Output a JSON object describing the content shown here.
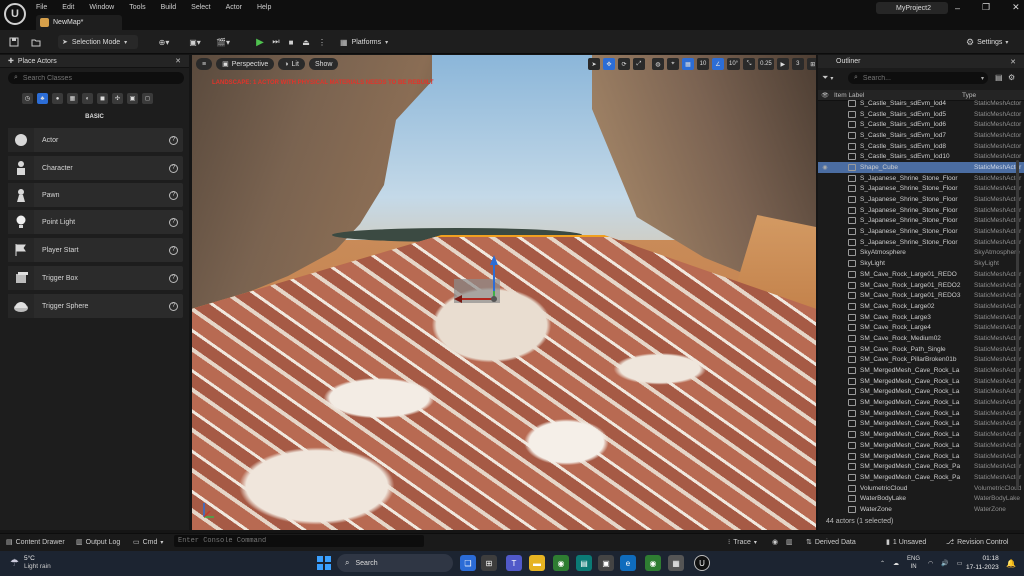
{
  "menu": [
    "File",
    "Edit",
    "Window",
    "Tools",
    "Build",
    "Select",
    "Actor",
    "Help"
  ],
  "map_tab": "NewMap*",
  "project_name": "MyProject2",
  "toolbar": {
    "selection_mode": "Selection Mode",
    "platforms": "Platforms",
    "settings": "Settings"
  },
  "place_actors": {
    "title": "Place Actors",
    "search_placeholder": "Search Classes",
    "section": "BASIC",
    "items": [
      "Actor",
      "Character",
      "Pawn",
      "Point Light",
      "Player Start",
      "Trigger Box",
      "Trigger Sphere"
    ]
  },
  "viewport": {
    "perspective": "Perspective",
    "lit": "Lit",
    "show": "Show",
    "warning": "LANDSCAPE: 1 ACTOR WITH PHYSICAL MATERIALS NEEDS TO BE REBUILT",
    "grid": "10",
    "angle": "10°",
    "scale": "0.25",
    "camera_speed": "3"
  },
  "outliner": {
    "title": "Outliner",
    "search_placeholder": "Search...",
    "col_label": "Item Label",
    "col_type": "Type",
    "rows": [
      {
        "name": "S_Castle_Stairs_sdEvm_lod4",
        "type": "StaticMeshActor"
      },
      {
        "name": "S_Castle_Stairs_sdEvm_lod5",
        "type": "StaticMeshActor"
      },
      {
        "name": "S_Castle_Stairs_sdEvm_lod6",
        "type": "StaticMeshActor"
      },
      {
        "name": "S_Castle_Stairs_sdEvm_lod7",
        "type": "StaticMeshActor"
      },
      {
        "name": "S_Castle_Stairs_sdEvm_lod8",
        "type": "StaticMeshActor"
      },
      {
        "name": "S_Castle_Stairs_sdEvm_lod10",
        "type": "StaticMeshActor"
      },
      {
        "name": "Shape_Cube",
        "type": "StaticMeshActor"
      },
      {
        "name": "S_Japanese_Shrine_Stone_Floor",
        "type": "StaticMeshActor"
      },
      {
        "name": "S_Japanese_Shrine_Stone_Floor",
        "type": "StaticMeshActor"
      },
      {
        "name": "S_Japanese_Shrine_Stone_Floor",
        "type": "StaticMeshActor"
      },
      {
        "name": "S_Japanese_Shrine_Stone_Floor",
        "type": "StaticMeshActor"
      },
      {
        "name": "S_Japanese_Shrine_Stone_Floor",
        "type": "StaticMeshActor"
      },
      {
        "name": "S_Japanese_Shrine_Stone_Floor",
        "type": "StaticMeshActor"
      },
      {
        "name": "S_Japanese_Shrine_Stone_Floor",
        "type": "StaticMeshActor"
      },
      {
        "name": "SkyAtmosphere",
        "type": "SkyAtmosphere"
      },
      {
        "name": "SkyLight",
        "type": "SkyLight"
      },
      {
        "name": "SM_Cave_Rock_Large01_REDO",
        "type": "StaticMeshActor"
      },
      {
        "name": "SM_Cave_Rock_Large01_REDO2",
        "type": "StaticMeshActor"
      },
      {
        "name": "SM_Cave_Rock_Large01_REDO3",
        "type": "StaticMeshActor"
      },
      {
        "name": "SM_Cave_Rock_Large02",
        "type": "StaticMeshActor"
      },
      {
        "name": "SM_Cave_Rock_Large3",
        "type": "StaticMeshActor"
      },
      {
        "name": "SM_Cave_Rock_Large4",
        "type": "StaticMeshActor"
      },
      {
        "name": "SM_Cave_Rock_Medium02",
        "type": "StaticMeshActor"
      },
      {
        "name": "SM_Cave_Rock_Path_Single",
        "type": "StaticMeshActor"
      },
      {
        "name": "SM_Cave_Rock_PillarBroken01b",
        "type": "StaticMeshActor"
      },
      {
        "name": "SM_MergedMesh_Cave_Rock_La",
        "type": "StaticMeshActor"
      },
      {
        "name": "SM_MergedMesh_Cave_Rock_La",
        "type": "StaticMeshActor"
      },
      {
        "name": "SM_MergedMesh_Cave_Rock_La",
        "type": "StaticMeshActor"
      },
      {
        "name": "SM_MergedMesh_Cave_Rock_La",
        "type": "StaticMeshActor"
      },
      {
        "name": "SM_MergedMesh_Cave_Rock_La",
        "type": "StaticMeshActor"
      },
      {
        "name": "SM_MergedMesh_Cave_Rock_La",
        "type": "StaticMeshActor"
      },
      {
        "name": "SM_MergedMesh_Cave_Rock_La",
        "type": "StaticMeshActor"
      },
      {
        "name": "SM_MergedMesh_Cave_Rock_La",
        "type": "StaticMeshActor"
      },
      {
        "name": "SM_MergedMesh_Cave_Rock_La",
        "type": "StaticMeshActor"
      },
      {
        "name": "SM_MergedMesh_Cave_Rock_Pa",
        "type": "StaticMeshActor"
      },
      {
        "name": "SM_MergedMesh_Cave_Rock_Pa",
        "type": "StaticMeshActor"
      },
      {
        "name": "VolumetricCloud",
        "type": "VolumetricCloud"
      },
      {
        "name": "WaterBodyLake",
        "type": "WaterBodyLake"
      },
      {
        "name": "WaterZone",
        "type": "WaterZone"
      }
    ],
    "footer": "44 actors (1 selected)"
  },
  "bottom": {
    "content_drawer": "Content Drawer",
    "output_log": "Output Log",
    "cmd": "Cmd",
    "console_placeholder": "Enter Console Command",
    "trace": "Trace",
    "derived_data": "Derived Data",
    "unsaved": "1 Unsaved",
    "revision": "Revision Control"
  },
  "taskbar": {
    "temp": "5°C",
    "weather": "Light rain",
    "search": "Search",
    "lang1": "ENG",
    "lang2": "IN",
    "time": "01:18",
    "date": "17-11-2023"
  },
  "colors": {
    "accent": "#2c6dd6",
    "selection": "#4b6da2",
    "warning": "#e2332a",
    "outline": "#f3a21f"
  }
}
